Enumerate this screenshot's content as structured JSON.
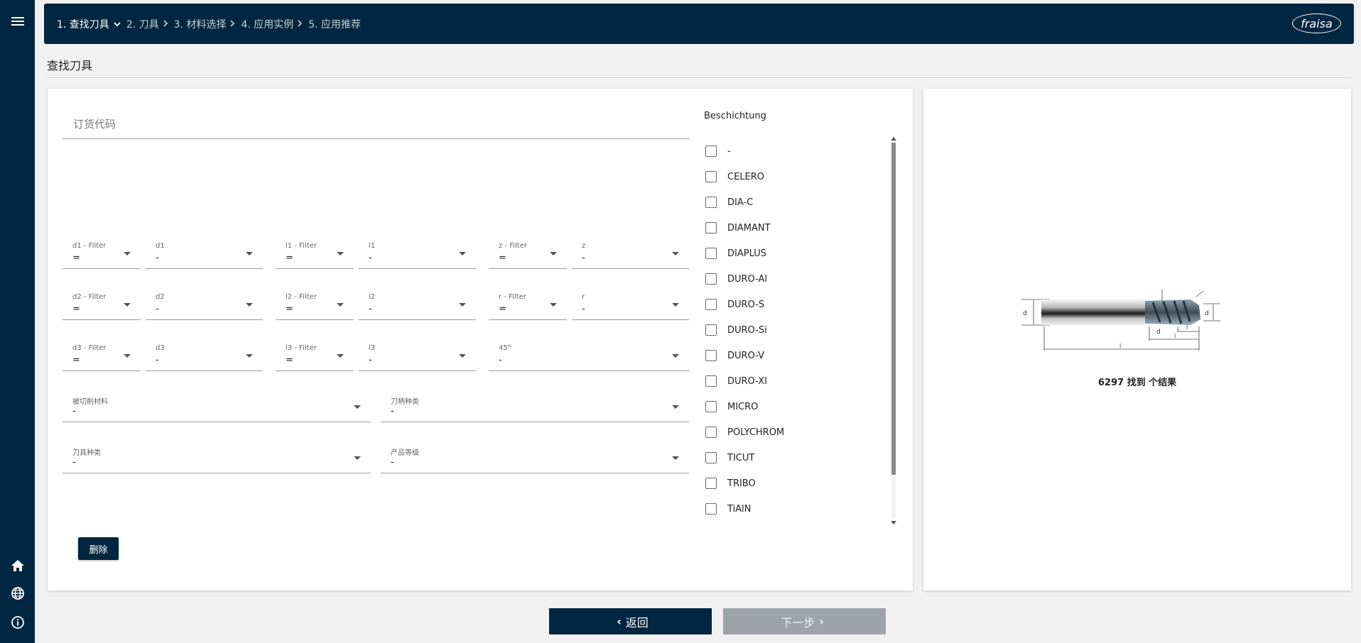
{
  "breadcrumb": {
    "steps": [
      {
        "label": "1. 查找刀具"
      },
      {
        "label": "2. 刀具"
      },
      {
        "label": "3. 材料选择"
      },
      {
        "label": "4. 应用实例"
      },
      {
        "label": "5. 应用推荐"
      }
    ]
  },
  "logo": {
    "text": "fraisa"
  },
  "page_title": "查找刀具",
  "order_code": {
    "placeholder": "订货代码"
  },
  "filters": {
    "d1_filter": {
      "label": "d1 - Filter",
      "value": "="
    },
    "d1": {
      "label": "d1",
      "value": "-"
    },
    "l1_filter": {
      "label": "l1 - Filter",
      "value": "="
    },
    "l1": {
      "label": "l1",
      "value": "-"
    },
    "z_filter": {
      "label": "z - Filter",
      "value": "="
    },
    "z": {
      "label": "z",
      "value": "-"
    },
    "d2_filter": {
      "label": "d2 - Filter",
      "value": "="
    },
    "d2": {
      "label": "d2",
      "value": "-"
    },
    "l2_filter": {
      "label": "l2 - Filter",
      "value": "="
    },
    "l2": {
      "label": "l2",
      "value": "-"
    },
    "r_filter": {
      "label": "r - Filter",
      "value": "="
    },
    "r": {
      "label": "r",
      "value": "-"
    },
    "d3_filter": {
      "label": "d3 - Filter",
      "value": "="
    },
    "d3": {
      "label": "d3",
      "value": "-"
    },
    "l3_filter": {
      "label": "l3 - Filter",
      "value": "="
    },
    "l3": {
      "label": "l3",
      "value": "-"
    },
    "angle45": {
      "label": "45°",
      "value": "-"
    },
    "material": {
      "label": "被切削材料",
      "value": "-"
    },
    "shank": {
      "label": "刀柄种类",
      "value": "-"
    },
    "tool_type": {
      "label": "刀具种类",
      "value": "-"
    },
    "grade": {
      "label": "产品等级",
      "value": "-"
    }
  },
  "delete_button": "删除",
  "coating": {
    "title": "Beschichtung",
    "items": [
      "-",
      "CELERO",
      "DIA-C",
      "DIAMANT",
      "DIAPLUS",
      "DURO-Al",
      "DURO-S",
      "DURO-Si",
      "DURO-V",
      "DURO-XI",
      "MICRO",
      "POLYCHROM",
      "TICUT",
      "TRIBO",
      "TiAlN"
    ]
  },
  "result": {
    "count": "6297",
    "text": "找到 个结果"
  },
  "nav": {
    "back": "返回",
    "next": "下一步"
  },
  "colors": {
    "primary": "#002641",
    "disabled": "#9ea3aa",
    "background": "#f1f1f1"
  }
}
